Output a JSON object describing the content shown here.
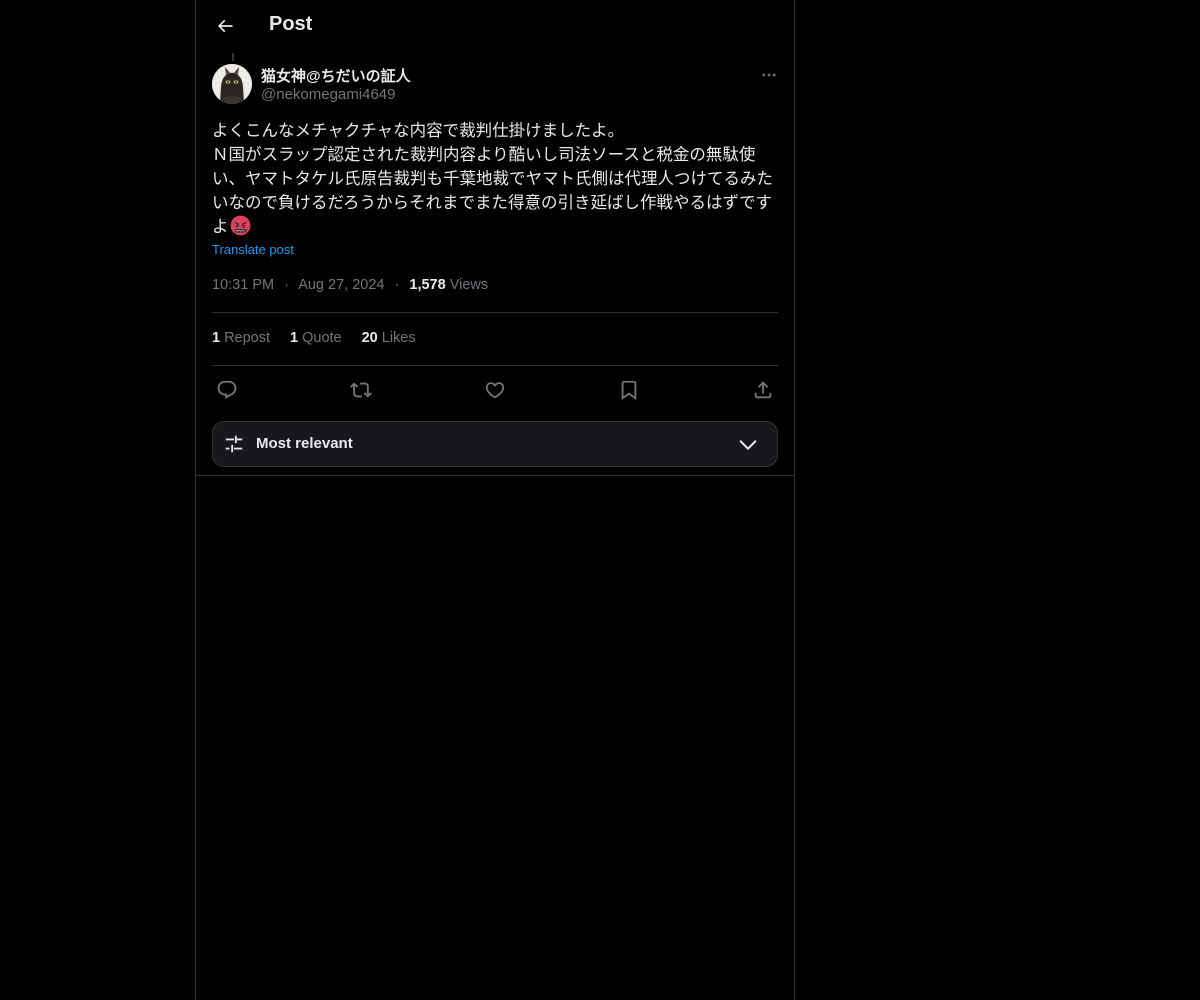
{
  "header": {
    "title": "Post"
  },
  "post": {
    "author_name": "猫女神@ちだいの証人",
    "author_handle": "@nekomegami4649",
    "text": "よくこんなメチャクチャな内容で裁判仕掛けましたよ。\nＮ国がスラップ認定された裁判内容より酷いし司法ソースと税金の無駄使い、ヤマトタケル氏原告裁判も千葉地裁でヤマト氏側は代理人つけてるみたいなので負けるだろうからそれまでまた得意の引き延ばし作戦やるはずですよ",
    "emoji_icon": "angry-face-icon",
    "translate_label": "Translate post",
    "time": "10:31 PM",
    "date": "Aug 27, 2024",
    "views_count": "1,578",
    "views_label": "Views",
    "separator": "·"
  },
  "stats": {
    "reposts_count": "1",
    "reposts_label": "Repost",
    "quotes_count": "1",
    "quotes_label": "Quote",
    "likes_count": "20",
    "likes_label": "Likes"
  },
  "sort": {
    "label": "Most relevant"
  },
  "colors": {
    "background": "#000000",
    "text_primary": "#e7e9ea",
    "text_secondary": "#71767b",
    "accent": "#1d9bf0",
    "border": "#2f3336"
  }
}
